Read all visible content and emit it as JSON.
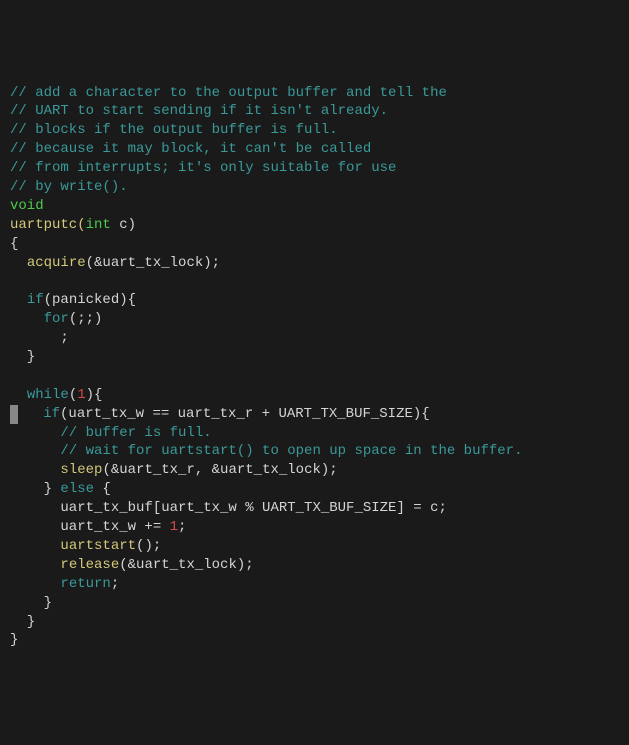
{
  "code": {
    "line1": "// add a character to the output buffer and tell the",
    "line2": "// UART to start sending if it isn't already.",
    "line3": "// blocks if the output buffer is full.",
    "line4": "// because it may block, it can't be called",
    "line5": "// from interrupts; it's only suitable for use",
    "line6": "// by write().",
    "line7_void": "void",
    "line8_func": "uartputc",
    "line8_type": "int",
    "line8_param": " c)",
    "line9": "{",
    "line10_indent": "  ",
    "line10_func": "acquire",
    "line10_args": "(&uart_tx_lock);",
    "line12_indent": "  ",
    "line12_if": "if",
    "line12_cond": "(panicked){",
    "line13_indent": "    ",
    "line13_for": "for",
    "line13_args": "(;;)",
    "line14": "      ;",
    "line15": "  }",
    "line17_indent": "  ",
    "line17_while": "while",
    "line17_num": "1",
    "line18_indent": "    ",
    "line18_if": "if",
    "line18_cond": "(uart_tx_w == uart_tx_r + UART_TX_BUF_SIZE){",
    "line19": "      // buffer is full.",
    "line20": "      // wait for uartstart() to open up space in the buffer.",
    "line21_indent": "      ",
    "line21_func": "sleep",
    "line21_args": "(&uart_tx_r, &uart_tx_lock);",
    "line22_indent": "    } ",
    "line22_else": "else",
    "line22_brace": " {",
    "line23": "      uart_tx_buf[uart_tx_w % UART_TX_BUF_SIZE] = c;",
    "line24_a": "      uart_tx_w += ",
    "line24_num": "1",
    "line24_b": ";",
    "line25_indent": "      ",
    "line25_func": "uartstart",
    "line25_args": "();",
    "line26_indent": "      ",
    "line26_func": "release",
    "line26_args": "(&uart_tx_lock);",
    "line27_indent": "      ",
    "line27_return": "return",
    "line27_semi": ";",
    "line28": "    }",
    "line29": "  }",
    "line30": "}"
  }
}
